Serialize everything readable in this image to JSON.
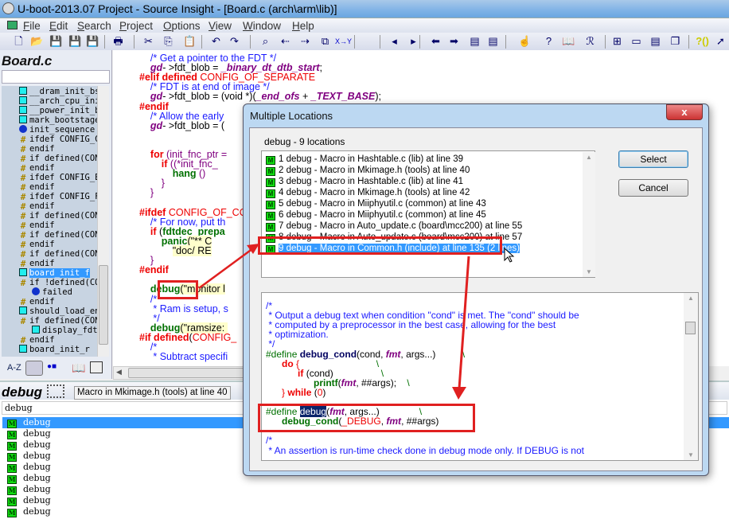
{
  "window": {
    "title": "U-boot-2013.07 Project - Source Insight - [Board.c (arch\\arm\\lib)]"
  },
  "menu": [
    "File",
    "Edit",
    "Search",
    "Project",
    "Options",
    "View",
    "Window",
    "Help"
  ],
  "toolbar": {
    "icons": [
      "new-file",
      "open",
      "save",
      "save-as",
      "save-all",
      "print",
      "cut",
      "copy",
      "paste",
      "undo",
      "redo",
      "find",
      "find-prev",
      "find-next",
      "find-in-files",
      "replace",
      "bookmark-back",
      "bookmark-forward",
      "back",
      "forward",
      "prev-block",
      "next-block",
      "jump-to-definition",
      "symbol-info",
      "reference",
      "browse-relations",
      "tile",
      "one-window",
      "split",
      "cascade",
      "help-symbol",
      "context-help"
    ],
    "replace_label": "X→Y",
    "help_label": "?()"
  },
  "symbol_panel": {
    "title": "Board.c",
    "search_value": "",
    "items": [
      {
        "icon": "function",
        "label": "__dram_init_bs",
        "indent": 0
      },
      {
        "icon": "function",
        "label": "__arch_cpu_ini",
        "indent": 0
      },
      {
        "icon": "function",
        "label": "__power_init_b",
        "indent": 0
      },
      {
        "icon": "function",
        "label": "mark_bootstage",
        "indent": 0
      },
      {
        "icon": "structure",
        "label": "init_sequence",
        "indent": 0
      },
      {
        "icon": "preprocessor",
        "label": "ifdef CONFIG_C",
        "indent": 0
      },
      {
        "icon": "preprocessor",
        "label": "endif",
        "indent": 0
      },
      {
        "icon": "preprocessor",
        "label": "if defined(CON",
        "indent": 0
      },
      {
        "icon": "preprocessor",
        "label": "endif",
        "indent": 0
      },
      {
        "icon": "preprocessor",
        "label": "ifdef CONFIG_E",
        "indent": 0
      },
      {
        "icon": "preprocessor",
        "label": "endif",
        "indent": 0
      },
      {
        "icon": "preprocessor",
        "label": "ifdef CONFIG_F",
        "indent": 0
      },
      {
        "icon": "preprocessor",
        "label": "endif",
        "indent": 0
      },
      {
        "icon": "preprocessor",
        "label": "if defined(CON",
        "indent": 0
      },
      {
        "icon": "preprocessor",
        "label": "endif",
        "indent": 0
      },
      {
        "icon": "preprocessor",
        "label": "if defined(CON",
        "indent": 0
      },
      {
        "icon": "preprocessor",
        "label": "endif",
        "indent": 0
      },
      {
        "icon": "preprocessor",
        "label": "if defined(CON",
        "indent": 0
      },
      {
        "icon": "preprocessor",
        "label": "endif",
        "indent": 0
      },
      {
        "icon": "function",
        "label": "board_init_f",
        "indent": 0,
        "selected": true
      },
      {
        "icon": "preprocessor",
        "label": "if !defined(CO",
        "indent": 0
      },
      {
        "icon": "structure",
        "label": "failed",
        "indent": 1
      },
      {
        "icon": "preprocessor",
        "label": "endif",
        "indent": 0
      },
      {
        "icon": "function",
        "label": "should_load_en",
        "indent": 0
      },
      {
        "icon": "preprocessor",
        "label": "if defined(CON",
        "indent": 0
      },
      {
        "icon": "function",
        "label": "display_fdt",
        "indent": 1
      },
      {
        "icon": "preprocessor",
        "label": "endif",
        "indent": 0
      },
      {
        "icon": "function",
        "label": "board_init_r",
        "indent": 0
      }
    ],
    "sort_label": "A-Z"
  },
  "editor": {
    "lines": [
      [
        [
          "    /* Get a pointer to the FDT */",
          "cm"
        ]
      ],
      [
        [
          "    ",
          "nm"
        ],
        [
          "gd",
          "gv"
        ],
        [
          "- >fdt_blob = ",
          "nm"
        ],
        [
          "_binary_dt_dtb_start",
          "gv"
        ],
        [
          ";",
          "nm"
        ]
      ],
      [
        [
          "#elif defined ",
          "pp2"
        ],
        [
          "CONFIG_OF_SEPARATE",
          "mac"
        ]
      ],
      [
        [
          "    /* FDT is at end of image */",
          "cm"
        ]
      ],
      [
        [
          "    ",
          "nm"
        ],
        [
          "gd",
          "gv"
        ],
        [
          "- >fdt_blob = (void *)(",
          "nm"
        ],
        [
          "_end_ofs",
          "gv"
        ],
        [
          " + ",
          "nm"
        ],
        [
          "_TEXT_BASE",
          "gv"
        ],
        [
          ");",
          "nm"
        ]
      ],
      [
        [
          "#endif",
          "pp2"
        ]
      ],
      [
        [
          "    /* Allow the early",
          "cm"
        ]
      ],
      [
        [
          "    ",
          "nm"
        ],
        [
          "gd",
          "gv"
        ],
        [
          "- >fdt_blob = (",
          "nm"
        ]
      ],
      [
        [
          "",
          ""
        ]
      ],
      [
        [
          "",
          ""
        ]
      ],
      [
        [
          "    ",
          "nm"
        ],
        [
          "for",
          "kw"
        ],
        [
          " (init_fnc_ptr =",
          "par"
        ]
      ],
      [
        [
          "        ",
          "nm"
        ],
        [
          "if",
          "kw"
        ],
        [
          " ((*init_fnc_",
          "par"
        ]
      ],
      [
        [
          "            ",
          "nm"
        ],
        [
          "hang",
          "fnc"
        ],
        [
          " ()",
          "par"
        ]
      ],
      [
        [
          "        }",
          "par"
        ]
      ],
      [
        [
          "    }",
          "par"
        ]
      ],
      [
        [
          "",
          ""
        ]
      ],
      [
        [
          "#ifdef ",
          "pp2"
        ],
        [
          "CONFIG_OF_CO",
          "mac"
        ]
      ],
      [
        [
          "    /* For now, put th",
          "cm"
        ]
      ],
      [
        [
          "    ",
          "nm"
        ],
        [
          "if",
          "kw"
        ],
        [
          " (",
          "nm"
        ],
        [
          "fdtdec_prepa",
          "fnc"
        ]
      ],
      [
        [
          "        ",
          "nm"
        ],
        [
          "panic",
          "fnc"
        ],
        [
          "(\"** C",
          "st2"
        ]
      ],
      [
        [
          "            ",
          "nm"
        ],
        [
          "\"doc/ RE",
          "st2"
        ]
      ],
      [
        [
          "    }",
          "par"
        ]
      ],
      [
        [
          "#endif",
          "pp2"
        ]
      ],
      [
        [
          "",
          ""
        ]
      ],
      [
        [
          "    ",
          "nm"
        ],
        [
          "debug",
          "fnc"
        ],
        [
          "(\"monitor l",
          "st2"
        ]
      ],
      [
        [
          "    /*",
          "cm"
        ]
      ],
      [
        [
          "     * Ram is setup, s",
          "cm"
        ]
      ],
      [
        [
          "     */",
          "cm"
        ]
      ],
      [
        [
          "    ",
          "nm"
        ],
        [
          "debug",
          "fnc"
        ],
        [
          "(\"ramsize: ",
          "st2"
        ]
      ],
      [
        [
          "#if defined",
          "pp2"
        ],
        [
          "(",
          "nm"
        ],
        [
          "CONFIG_",
          "mac"
        ]
      ],
      [
        [
          "    /*",
          "cm"
        ]
      ],
      [
        [
          "     * Subtract specifi",
          "cm"
        ]
      ]
    ]
  },
  "relation_panel": {
    "title": "debug",
    "info": "Macro in Mkimage.h (tools) at line 40",
    "search_value": "debug",
    "items": [
      "debug",
      "debug",
      "debug",
      "debug",
      "debug",
      "debug",
      "debug",
      "debug",
      "debug"
    ]
  },
  "dialog": {
    "title": "Multiple Locations",
    "close_label": "x",
    "count_label": "debug - 9 locations",
    "locations": [
      "1 debug - Macro in Hashtable.c (lib) at line 39",
      "2 debug - Macro in Mkimage.h (tools) at line 40",
      "3 debug - Macro in Hashtable.c (lib) at line 41",
      "4 debug - Macro in Mkimage.h (tools) at line 42",
      "5 debug - Macro in Miiphyutil.c (common) at line 43",
      "6 debug - Macro in Miiphyutil.c (common) at line 45",
      "7 debug - Macro in Auto_update.c (board\\mcc200) at line 55",
      "8 debug - Macro in Auto_update.c (board\\mcc200) at line 57",
      "9 debug - Macro in Common.h (include) at line 135 (2 lines)"
    ],
    "selected_index": 8,
    "select_label": "Select",
    "cancel_label": "Cancel",
    "preview": [
      [
        [
          "/*",
          "cm"
        ]
      ],
      [
        [
          " * Output a debug text when condition \"cond\" is met. The \"cond\" should be",
          "cm"
        ]
      ],
      [
        [
          " * computed by a preprocessor in the best case, allowing for the best",
          "cm"
        ]
      ],
      [
        [
          " * optimization.",
          "cm"
        ]
      ],
      [
        [
          " */",
          "cm"
        ]
      ],
      [
        [
          "#define ",
          "gr"
        ],
        [
          "debug_cond",
          "dn"
        ],
        [
          "(cond, ",
          "nm"
        ],
        [
          "fmt",
          "gv"
        ],
        [
          ", args...)          ",
          "nm"
        ],
        [
          "\\",
          "gr"
        ]
      ],
      [
        [
          "      ",
          "nm"
        ],
        [
          "do",
          "kw"
        ],
        [
          " {                             ",
          "mac"
        ],
        [
          "\\",
          "gr"
        ]
      ],
      [
        [
          "            ",
          "nm"
        ],
        [
          "if",
          "kw"
        ],
        [
          " (cond)                  ",
          "nm"
        ],
        [
          "\\",
          "gr"
        ]
      ],
      [
        [
          "                  ",
          "nm"
        ],
        [
          "printf",
          "fnc"
        ],
        [
          "(",
          "nm"
        ],
        [
          "fmt",
          "gv"
        ],
        [
          ", ##args);    ",
          "nm"
        ],
        [
          "\\",
          "gr"
        ]
      ],
      [
        [
          "      } ",
          "mac"
        ],
        [
          "while",
          "kw"
        ],
        [
          " (",
          "nm"
        ],
        [
          "0",
          "mac"
        ],
        [
          ")",
          "nm"
        ]
      ],
      [
        [
          "",
          ""
        ]
      ],
      [
        [
          "#define ",
          "gr"
        ],
        [
          "debug",
          "hl"
        ],
        [
          "(",
          "nm"
        ],
        [
          "fmt",
          "gv"
        ],
        [
          ", args...)               ",
          "nm"
        ],
        [
          "\\",
          "gr"
        ]
      ],
      [
        [
          "      ",
          "nm"
        ],
        [
          "debug_cond",
          "fnc"
        ],
        [
          "(",
          "nm"
        ],
        [
          "_DEBUG",
          "mac"
        ],
        [
          ", ",
          "nm"
        ],
        [
          "fmt",
          "gv"
        ],
        [
          ", ##args)",
          "nm"
        ]
      ],
      [
        [
          "",
          ""
        ]
      ],
      [
        [
          "/*",
          "cm"
        ]
      ],
      [
        [
          " * An assertion is run-time check done in debug mode only. If DEBUG is not",
          "cm"
        ]
      ]
    ]
  },
  "colors": {
    "selection": "#3399ff",
    "annotation_red": "#e02020",
    "comment": "#1a1aff",
    "preprocessor": "#e00000"
  }
}
